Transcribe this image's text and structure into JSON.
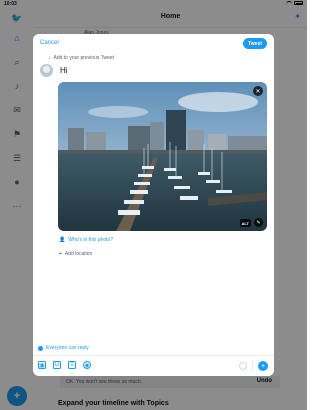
{
  "status_bar": {
    "time": "10:03"
  },
  "header": {
    "title": "Home"
  },
  "background": {
    "tweet_user": "Alan Jones",
    "undo_text": "OK. You won't see these as much.",
    "undo_label": "Undo",
    "topics_heading": "Expand your timeline with Topics"
  },
  "sidebar": {
    "icons": [
      "twitter-logo-icon",
      "home-icon",
      "search-icon",
      "notifications-icon",
      "messages-icon",
      "bookmarks-icon",
      "lists-icon",
      "profile-icon",
      "more-icon"
    ]
  },
  "compose": {
    "cancel_label": "Cancel",
    "tweet_label": "Tweet",
    "add_previous": "Add to your previous Tweet",
    "text": "Hi",
    "photo": {
      "alt_label": "ALT"
    },
    "tag_label": "Who's in this photo?",
    "location_label": "Add location",
    "reply_setting": "Everyone can reply"
  },
  "colors": {
    "accent": "#1d9bf0",
    "overlay": "rgba(0,0,0,0.45)"
  }
}
